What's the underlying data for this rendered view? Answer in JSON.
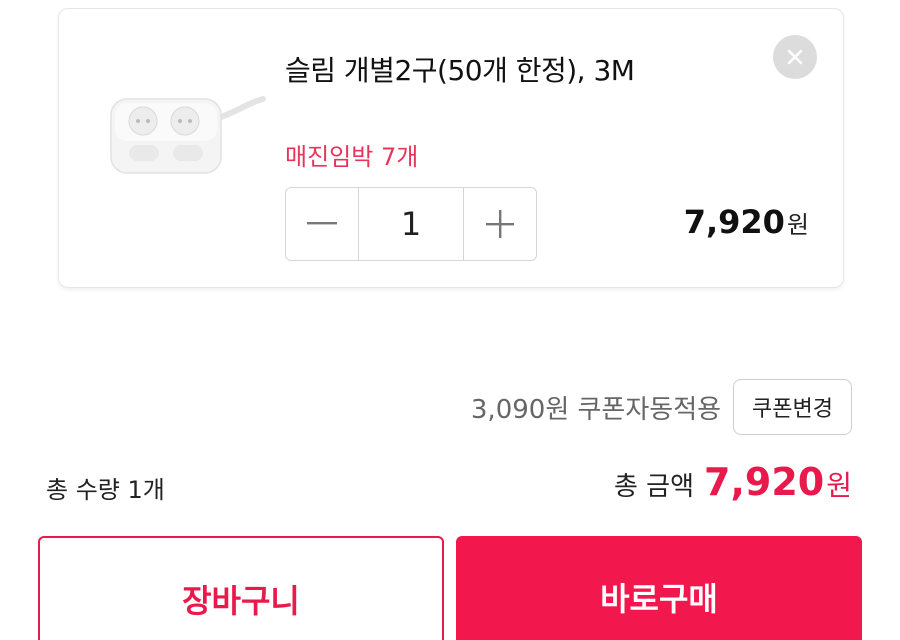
{
  "product": {
    "title": "슬림 개별2구(50개 한정), 3M",
    "stock_text": "매진임박 7개",
    "image_icon": "power-strip-image",
    "close_icon": "close-icon",
    "quantity": "1",
    "minus_icon": "minus-icon",
    "plus_icon": "plus-icon",
    "price": "7,920",
    "price_unit": "원"
  },
  "coupon": {
    "text": "3,090원 쿠폰자동적용",
    "change_label": "쿠폰변경"
  },
  "summary": {
    "total_quantity": "총 수량 1개",
    "total_label": "총 금액",
    "total_value": "7,920",
    "total_unit": "원"
  },
  "actions": {
    "cart_label": "장바구니",
    "buy_label": "바로구매"
  },
  "colors": {
    "accent": "#e8194b",
    "stock": "#e8345a"
  }
}
